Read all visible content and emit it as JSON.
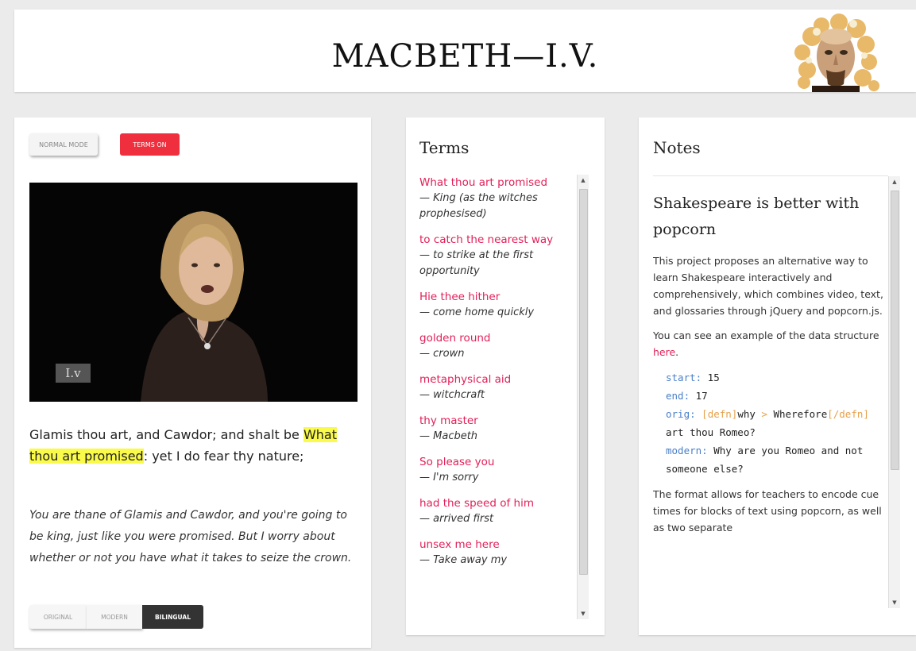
{
  "header": {
    "title": "MACBETH—I.V."
  },
  "video_panel": {
    "normal_mode_label": "Normal mode",
    "terms_on_label": "Terms on",
    "video_label": "I.v",
    "original": {
      "before": "Glamis thou art, and Cawdor; and shalt be ",
      "highlight": "What thou art promised",
      "after": ": yet I do fear thy nature;"
    },
    "modern": "You are thane of Glamis and Cawdor, and you're going to be king, just like you were promised. But I worry about whether or not you have what it takes to seize the crown.",
    "toggle": {
      "original": "Original",
      "modern": "Modern",
      "bilingual": "Bilingual"
    }
  },
  "terms_panel": {
    "title": "Terms",
    "terms": [
      {
        "word": "What thou art promised",
        "def": "— King (as the witches prophesised)"
      },
      {
        "word": "to catch the nearest way",
        "def": "— to strike at the first opportunity"
      },
      {
        "word": "Hie thee hither",
        "def": "— come home quickly"
      },
      {
        "word": "golden round",
        "def": "— crown"
      },
      {
        "word": "metaphysical aid",
        "def": "— witchcraft"
      },
      {
        "word": "thy master",
        "def": "— Macbeth"
      },
      {
        "word": "So please you",
        "def": "— I'm sorry"
      },
      {
        "word": "had the speed of him",
        "def": "— arrived first"
      },
      {
        "word": "unsex me here",
        "def": "— Take away my"
      }
    ]
  },
  "notes_panel": {
    "title": "Notes",
    "heading": "Shakespeare is better with popcorn",
    "p1": "This project proposes an alternative way to learn Shakespeare interactively and comprehensively, which combines video, text, and glossaries through jQuery and popcorn.js.",
    "p2_before": "You can see an example of the data structure ",
    "p2_link": "here",
    "p2_after": ".",
    "code": {
      "start_key": "start:",
      "start_val": " 15",
      "end_key": "end:",
      "end_val": " 17",
      "orig_key": "orig:",
      "orig_tag_open": " [defn]",
      "orig_why": "why",
      "orig_gt": " >",
      "orig_word": "Wherefore",
      "orig_tag_close": "[/defn]",
      "orig_rest": " art thou Romeo?",
      "modern_key": "modern:",
      "modern_val": " Why are you Romeo and not someone else?"
    },
    "p3": "The format allows for teachers to encode cue times for blocks of text using popcorn, as well as two separate"
  }
}
